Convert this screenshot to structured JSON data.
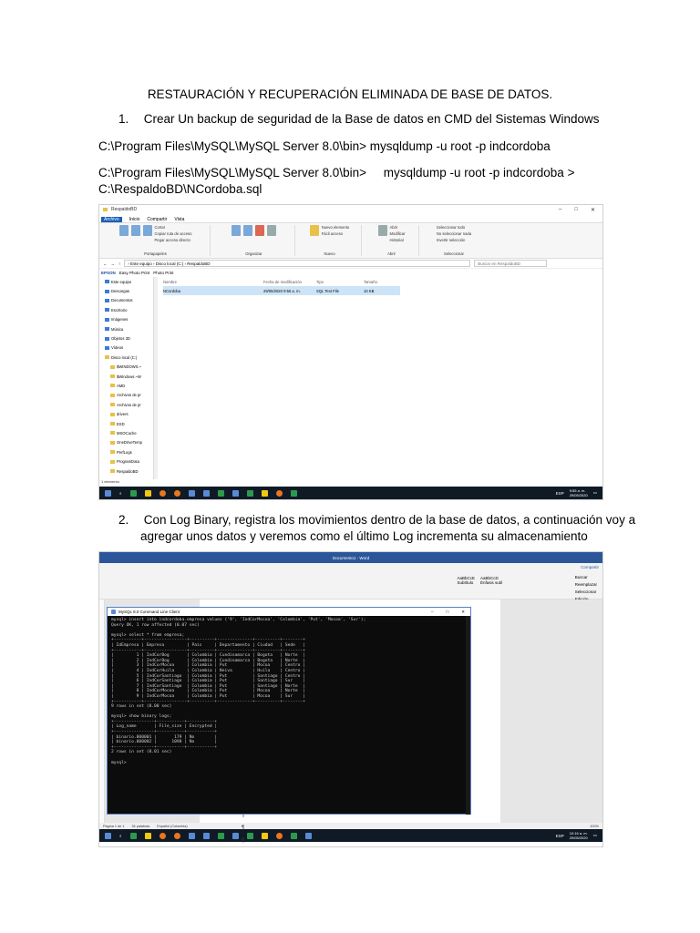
{
  "document": {
    "title": "RESTAURACIÓN Y RECUPERACIÓN ELIMINADA DE BASE DE DATOS.",
    "step1_number": "1.",
    "step1_text": "Crear Un backup de seguridad de la Base de datos en CMD del Sistemas Windows",
    "cmd_line1": "C:\\Program Files\\MySQL\\MySQL Server 8.0\\bin>     mysqldump -u root -p indcordoba",
    "cmd_line2a": "C:\\Program Files\\MySQL\\MySQL Server 8.0\\bin>     mysqldump -u root -p indcordoba >",
    "cmd_line2b": "C:\\RespaldoBD\\NCordoba.sql",
    "step2_number": "2.",
    "step2_line1": "Con Log Binary, registra los movimientos dentro de la base de datos, a continuación voy a",
    "step2_line2": "agregar unos datos y veremos como el último Log incrementa su almacenamiento"
  },
  "explorer": {
    "window_title": "RespaldoBD",
    "window_controls": [
      "–",
      "□",
      "✕"
    ],
    "tabs": [
      "Archivo",
      "Inicio",
      "Compartir",
      "Vista"
    ],
    "ribbon_groups": [
      {
        "name": "Portapapeles",
        "items": [
          "Anclar al Acceso rápido",
          "Copiar",
          "Pegar",
          "Cortar",
          "Copiar ruta de acceso",
          "Pegar acceso directo"
        ]
      },
      {
        "name": "Organizar",
        "items": [
          "Mover a",
          "Copiar a",
          "Eliminar",
          "Cambiar nombre"
        ]
      },
      {
        "name": "Nuevo",
        "items": [
          "Nueva carpeta",
          "Nuevo elemento",
          "Fácil acceso"
        ]
      },
      {
        "name": "Abrir",
        "items": [
          "Propiedades",
          "Abrir",
          "Modificar",
          "Historial"
        ]
      },
      {
        "name": "Seleccionar",
        "items": [
          "Seleccionar todo",
          "No seleccionar nada",
          "Invertir selección"
        ]
      }
    ],
    "address_path": "› Este equipo › Disco local (C:) › RespaldoBD",
    "search_placeholder": "Buscar en RespaldoBD",
    "epson_label": "EPSON",
    "epson_items": [
      "Easy Photo Print",
      "Photo Print"
    ],
    "nav_items": [
      "Este equipo",
      "Descargas",
      "Documentos",
      "Escritorio",
      "Imágenes",
      "Música",
      "Objetos 3D",
      "Vídeos",
      "Disco local (C:)",
      "$WINDOWS.~",
      "$Windows.~W",
      "AMD",
      "Archivos de pr",
      "Archivos de pr",
      "drivers",
      "ESD",
      "MSOCache",
      "OneDriveTemp",
      "PerfLogs",
      "ProgramData",
      "RespaldoBD"
    ],
    "columns": [
      "Nombre",
      "Fecha de modificación",
      "Tipo",
      "Tamaño"
    ],
    "files": [
      {
        "name": "NCordoba",
        "date": "29/05/2020 9:55 a. m.",
        "type": "SQL Text File",
        "size": "10 KB"
      }
    ],
    "status": "1 elemento"
  },
  "taskbar": {
    "time": "9:55 a. m.",
    "date": "29/05/2020",
    "lang": "ESP",
    "time2": "10:16 a. m.",
    "date2": "29/05/2020"
  },
  "word": {
    "title": "Documento1 - Word",
    "share": "Compartir",
    "styles": [
      "AaBbCcE",
      "AaBbCcD"
    ],
    "style_names": [
      "Subtítulo",
      "Énfasis sutil"
    ],
    "find_items": [
      "Buscar",
      "Reemplazar",
      "Seleccionar",
      "Edición"
    ],
    "status": [
      "Página 1 de 1",
      "34 palabras",
      "Español (Colombia)"
    ],
    "zoom": "100%"
  },
  "cmd": {
    "title": "MySQL 8.0 Command Line Client",
    "output": "mysql> insert into indcordoba.empresa values ('9', 'IndCorMocoa', 'Colombia', 'Put', 'Mocoa', 'Sur');\nQuery OK, 1 row affected (0.07 sec)\n\nmysql> select * from empresa;\n+-----------+-----------------+----------+--------------+----------+--------+\n| IdEmpresa | Empresa         | Pais     | Departamento | Ciudad   | Sede   |\n+-----------+-----------------+----------+--------------+----------+--------+\n|         1 | IndCorBog       | Colombia | Cundinamarca | Bogota   | Norte  |\n|         2 | IndCorBog       | Colombia | Cundinamarca | Bogota   | Norte  |\n|         3 | IndCorMocoa     | Colombia | Put          | Mocoa    | Centro |\n|         4 | IndCorHuila     | Colombia | Neiva        | Huila    | Centro |\n|         5 | IndCorSantiago  | Colombia | Put          | Santiago | Centro |\n|         6 | IndCorSantiago  | Colombia | Put          | Santiago | Sur    |\n|         7 | IndCorSantiago  | Colombia | Put          | Santiago | Norte  |\n|         8 | IndCorMocoa     | Colombia | Put          | Mocoa    | Norte  |\n|         9 | IndCorMocoa     | Colombia | Put          | Mocoa    | Sur    |\n+-----------+-----------------+----------+--------------+----------+--------+\n9 rows in set (0.00 sec)\n\nmysql> show binary logs;\n+----------------+-----------+-----------+\n| Log_name       | File_size | Encrypted |\n+----------------+-----------+-----------+\n| binario.000001 |       179 | No        |\n| binario.000002 |      1098 | No        |\n+----------------+-----------+-----------+\n2 rows in set (0.01 sec)\n\nmysql>"
  }
}
